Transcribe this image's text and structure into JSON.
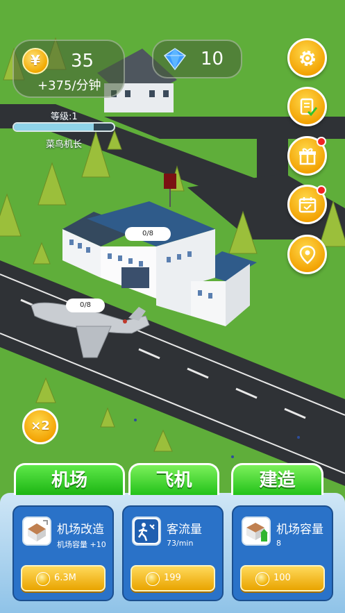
{
  "hud": {
    "coins": "35",
    "coin_rate": "+375/分钟",
    "gems": "10",
    "level_label": "等级:1",
    "level_progress": 0.8,
    "rank_label": "菜鸟机长"
  },
  "side_buttons": [
    {
      "icon": "gear-icon",
      "badge": false
    },
    {
      "icon": "task-list-icon",
      "badge": false
    },
    {
      "icon": "gift-icon",
      "badge": true
    },
    {
      "icon": "calendar-icon",
      "badge": true
    },
    {
      "icon": "location-pin-icon",
      "badge": false
    }
  ],
  "boost": {
    "label": "×2"
  },
  "map": {
    "terminal_capacity": "0/8",
    "plane_capacity": "0/8"
  },
  "tabs": [
    {
      "label": "机场",
      "active": true
    },
    {
      "label": "飞机",
      "active": false
    },
    {
      "label": "建造",
      "active": false
    }
  ],
  "cards": [
    {
      "icon": "terminal-upgrade-icon",
      "title": "机场改造",
      "subtitle": "机场容量  +10",
      "price": "6.3M"
    },
    {
      "icon": "passenger-flow-icon",
      "title": "客流量",
      "subtitle": "73/min",
      "price": "199"
    },
    {
      "icon": "airport-capacity-icon",
      "title": "机场容量",
      "subtitle": "8",
      "price": "100"
    }
  ],
  "colors": {
    "grass": "#5fae3a",
    "road": "#2f3236",
    "accent_gold": "#f2a000",
    "tab_green": "#23c21a",
    "card_blue": "#2a72c8"
  }
}
